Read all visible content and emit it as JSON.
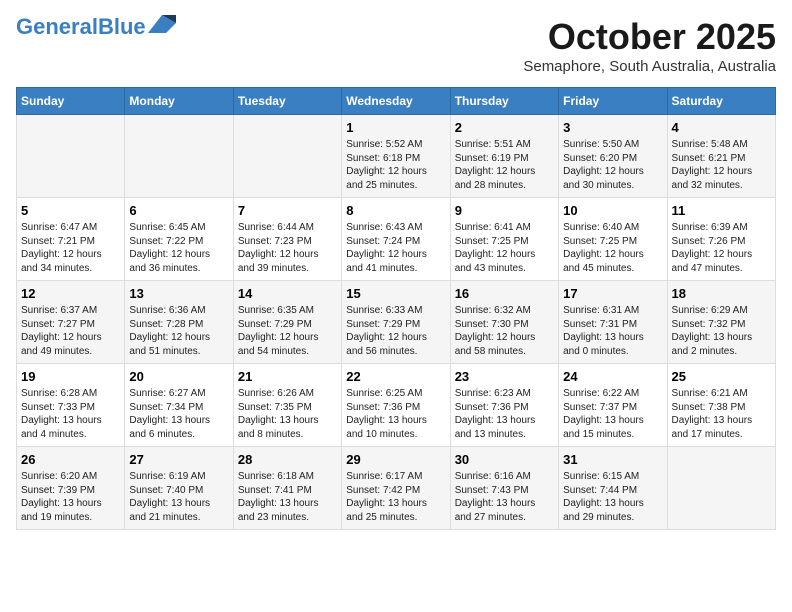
{
  "header": {
    "logo_general": "General",
    "logo_blue": "Blue",
    "month": "October 2025",
    "location": "Semaphore, South Australia, Australia"
  },
  "weekdays": [
    "Sunday",
    "Monday",
    "Tuesday",
    "Wednesday",
    "Thursday",
    "Friday",
    "Saturday"
  ],
  "weeks": [
    [
      {
        "day": "",
        "info": ""
      },
      {
        "day": "",
        "info": ""
      },
      {
        "day": "",
        "info": ""
      },
      {
        "day": "1",
        "info": "Sunrise: 5:52 AM\nSunset: 6:18 PM\nDaylight: 12 hours\nand 25 minutes."
      },
      {
        "day": "2",
        "info": "Sunrise: 5:51 AM\nSunset: 6:19 PM\nDaylight: 12 hours\nand 28 minutes."
      },
      {
        "day": "3",
        "info": "Sunrise: 5:50 AM\nSunset: 6:20 PM\nDaylight: 12 hours\nand 30 minutes."
      },
      {
        "day": "4",
        "info": "Sunrise: 5:48 AM\nSunset: 6:21 PM\nDaylight: 12 hours\nand 32 minutes."
      }
    ],
    [
      {
        "day": "5",
        "info": "Sunrise: 6:47 AM\nSunset: 7:21 PM\nDaylight: 12 hours\nand 34 minutes."
      },
      {
        "day": "6",
        "info": "Sunrise: 6:45 AM\nSunset: 7:22 PM\nDaylight: 12 hours\nand 36 minutes."
      },
      {
        "day": "7",
        "info": "Sunrise: 6:44 AM\nSunset: 7:23 PM\nDaylight: 12 hours\nand 39 minutes."
      },
      {
        "day": "8",
        "info": "Sunrise: 6:43 AM\nSunset: 7:24 PM\nDaylight: 12 hours\nand 41 minutes."
      },
      {
        "day": "9",
        "info": "Sunrise: 6:41 AM\nSunset: 7:25 PM\nDaylight: 12 hours\nand 43 minutes."
      },
      {
        "day": "10",
        "info": "Sunrise: 6:40 AM\nSunset: 7:25 PM\nDaylight: 12 hours\nand 45 minutes."
      },
      {
        "day": "11",
        "info": "Sunrise: 6:39 AM\nSunset: 7:26 PM\nDaylight: 12 hours\nand 47 minutes."
      }
    ],
    [
      {
        "day": "12",
        "info": "Sunrise: 6:37 AM\nSunset: 7:27 PM\nDaylight: 12 hours\nand 49 minutes."
      },
      {
        "day": "13",
        "info": "Sunrise: 6:36 AM\nSunset: 7:28 PM\nDaylight: 12 hours\nand 51 minutes."
      },
      {
        "day": "14",
        "info": "Sunrise: 6:35 AM\nSunset: 7:29 PM\nDaylight: 12 hours\nand 54 minutes."
      },
      {
        "day": "15",
        "info": "Sunrise: 6:33 AM\nSunset: 7:29 PM\nDaylight: 12 hours\nand 56 minutes."
      },
      {
        "day": "16",
        "info": "Sunrise: 6:32 AM\nSunset: 7:30 PM\nDaylight: 12 hours\nand 58 minutes."
      },
      {
        "day": "17",
        "info": "Sunrise: 6:31 AM\nSunset: 7:31 PM\nDaylight: 13 hours\nand 0 minutes."
      },
      {
        "day": "18",
        "info": "Sunrise: 6:29 AM\nSunset: 7:32 PM\nDaylight: 13 hours\nand 2 minutes."
      }
    ],
    [
      {
        "day": "19",
        "info": "Sunrise: 6:28 AM\nSunset: 7:33 PM\nDaylight: 13 hours\nand 4 minutes."
      },
      {
        "day": "20",
        "info": "Sunrise: 6:27 AM\nSunset: 7:34 PM\nDaylight: 13 hours\nand 6 minutes."
      },
      {
        "day": "21",
        "info": "Sunrise: 6:26 AM\nSunset: 7:35 PM\nDaylight: 13 hours\nand 8 minutes."
      },
      {
        "day": "22",
        "info": "Sunrise: 6:25 AM\nSunset: 7:36 PM\nDaylight: 13 hours\nand 10 minutes."
      },
      {
        "day": "23",
        "info": "Sunrise: 6:23 AM\nSunset: 7:36 PM\nDaylight: 13 hours\nand 13 minutes."
      },
      {
        "day": "24",
        "info": "Sunrise: 6:22 AM\nSunset: 7:37 PM\nDaylight: 13 hours\nand 15 minutes."
      },
      {
        "day": "25",
        "info": "Sunrise: 6:21 AM\nSunset: 7:38 PM\nDaylight: 13 hours\nand 17 minutes."
      }
    ],
    [
      {
        "day": "26",
        "info": "Sunrise: 6:20 AM\nSunset: 7:39 PM\nDaylight: 13 hours\nand 19 minutes."
      },
      {
        "day": "27",
        "info": "Sunrise: 6:19 AM\nSunset: 7:40 PM\nDaylight: 13 hours\nand 21 minutes."
      },
      {
        "day": "28",
        "info": "Sunrise: 6:18 AM\nSunset: 7:41 PM\nDaylight: 13 hours\nand 23 minutes."
      },
      {
        "day": "29",
        "info": "Sunrise: 6:17 AM\nSunset: 7:42 PM\nDaylight: 13 hours\nand 25 minutes."
      },
      {
        "day": "30",
        "info": "Sunrise: 6:16 AM\nSunset: 7:43 PM\nDaylight: 13 hours\nand 27 minutes."
      },
      {
        "day": "31",
        "info": "Sunrise: 6:15 AM\nSunset: 7:44 PM\nDaylight: 13 hours\nand 29 minutes."
      },
      {
        "day": "",
        "info": ""
      }
    ]
  ]
}
